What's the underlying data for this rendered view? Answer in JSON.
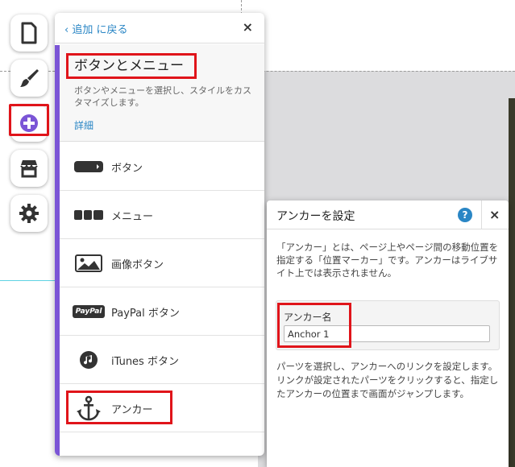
{
  "rail": {
    "pages_icon": "page-icon",
    "design_icon": "brush-icon",
    "add_icon": "plus-circle-icon",
    "store_icon": "store-icon",
    "settings_icon": "gear-icon"
  },
  "add_panel": {
    "back_label": "追加 に戻る",
    "close_glyph": "×",
    "title": "ボタンとメニュー",
    "description": "ボタンやメニューを選択し、スタイルをカスタマイズします。",
    "more_link": "詳細",
    "items": [
      {
        "label": "ボタン",
        "icon": "button-shape-icon"
      },
      {
        "label": "メニュー",
        "icon": "menu-shape-icon"
      },
      {
        "label": "画像ボタン",
        "icon": "image-button-icon"
      },
      {
        "label": "PayPal ボタン",
        "icon": "paypal-icon"
      },
      {
        "label": "iTunes ボタン",
        "icon": "itunes-icon"
      },
      {
        "label": "アンカー",
        "icon": "anchor-icon"
      }
    ],
    "paypal_badge": "PayPal"
  },
  "anchor_panel": {
    "title": "アンカーを設定",
    "help_glyph": "?",
    "close_glyph": "×",
    "description": "「アンカー」とは、ページ上やページ間の移動位置を指定する「位置マーカー」です。アンカーはライブサイト上では表示されません。",
    "field_label": "アンカー名",
    "field_value": "Anchor 1",
    "help_text": "パーツを選択し、アンカーへのリンクを設定します。リンクが設定されたパーツをクリックすると、指定したアンカーの位置まで画面がジャンプします。"
  },
  "colors": {
    "accent": "#7b55d6",
    "link": "#2a86c5",
    "highlight": "#e0141a"
  }
}
